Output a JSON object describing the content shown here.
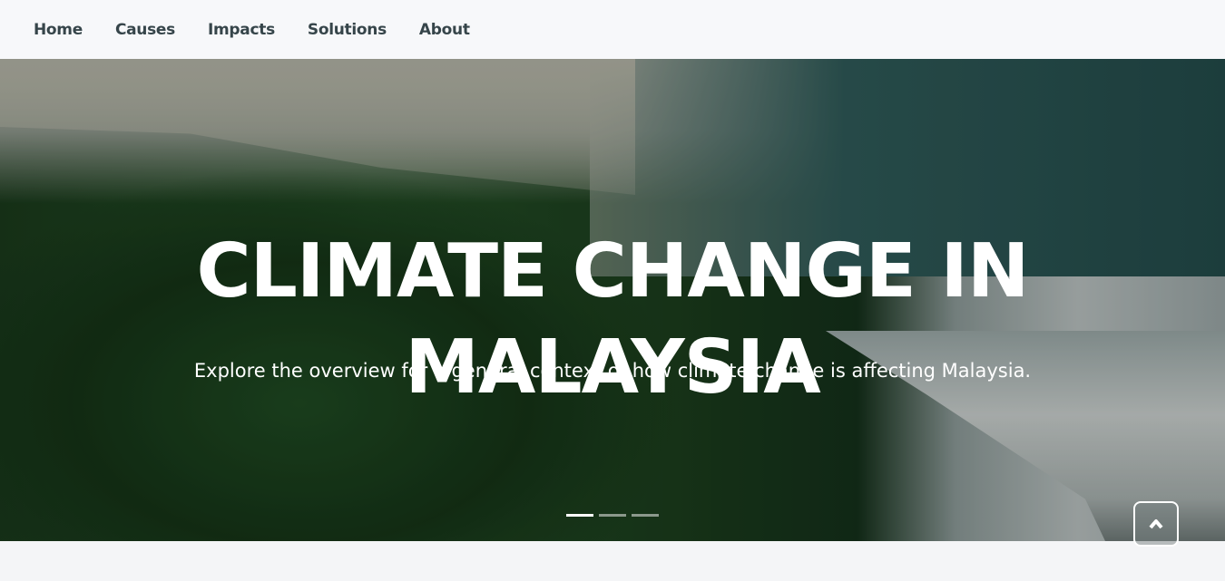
{
  "nav": {
    "items": [
      "Home",
      "Causes",
      "Impacts",
      "Solutions",
      "About"
    ]
  },
  "hero": {
    "title": "CLIMATE CHANGE IN MALAYSIA",
    "subtitle": "Explore the overview for a general context of how climate change is affecting Malaysia.",
    "carousel": {
      "slides": 3,
      "active": 1
    }
  },
  "back_to_top": {
    "icon": "chevron-up-icon"
  }
}
